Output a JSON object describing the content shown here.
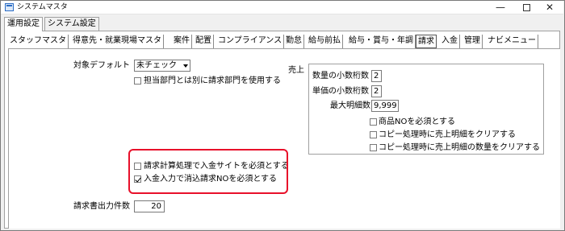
{
  "window": {
    "title": "システムマスタ",
    "buttons": {
      "minimize": "—",
      "close": "✕"
    }
  },
  "top_tabs": [
    {
      "label": "運用設定",
      "active": true
    },
    {
      "label": "システム設定",
      "active": false
    }
  ],
  "sub_tabs": [
    {
      "label": "スタッフマスタ",
      "active": false
    },
    {
      "label": "得意先・就業現場マスタ",
      "active": false
    },
    {
      "label": "案件",
      "active": false
    },
    {
      "label": "配置",
      "active": false
    },
    {
      "label": "コンプライアンス",
      "active": false
    },
    {
      "label": "勤怠",
      "active": false
    },
    {
      "label": "給与前払",
      "active": false
    },
    {
      "label": "給与・賞与・年調",
      "active": false
    },
    {
      "label": "請求",
      "active": true
    },
    {
      "label": "入金",
      "active": false
    },
    {
      "label": "管理",
      "active": false
    },
    {
      "label": "ナビメニュー",
      "active": false
    }
  ],
  "left": {
    "target_default_label": "対象デフォルト",
    "target_default_value": "未チェック",
    "use_billing_dept_label": "担当部門とは別に請求部門を使用する",
    "use_billing_dept_checked": false,
    "require_deposit_site_label": "請求計算処理で入金サイトを必須とする",
    "require_deposit_site_checked": false,
    "require_settlement_no_label": "入金入力で消込請求NOを必須とする",
    "require_settlement_no_checked": true,
    "invoice_output_count_label": "請求書出力件数",
    "invoice_output_count_value": "20"
  },
  "sales": {
    "title": "売上",
    "qty_decimals_label": "数量の小数桁数",
    "qty_decimals_value": "2",
    "unit_decimals_label": "単価の小数桁数",
    "unit_decimals_value": "2",
    "max_details_label": "最大明細数",
    "max_details_value": "9,999",
    "require_product_no_label": "商品NOを必須とする",
    "require_product_no_checked": false,
    "clear_details_on_copy_label": "コピー処理時に売上明細をクリアする",
    "clear_details_on_copy_checked": false,
    "clear_qty_on_copy_label": "コピー処理時に売上明細の数量をクリアする",
    "clear_qty_on_copy_checked": false
  },
  "colors": {
    "highlight": "#e8102a"
  }
}
